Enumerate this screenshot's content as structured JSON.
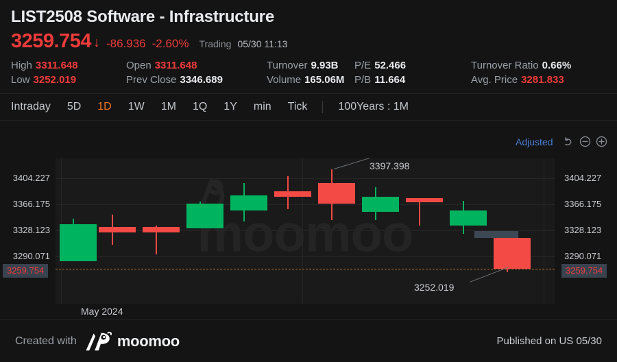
{
  "header": {
    "title": "LIST2508 Software - Infrastructure",
    "price": "3259.754",
    "arrow": "down-arrow-icon",
    "change": "-86.936",
    "change_pct": "-2.60%",
    "status": "Trading",
    "timestamp": "05/30 11:13",
    "accent_down": "#ef3b3a",
    "accent_active": "#f07423"
  },
  "stats": [
    {
      "key": "High",
      "value": "3311.648",
      "red": true
    },
    {
      "key": "Open",
      "value": "3311.648",
      "red": true
    },
    {
      "key": "Turnover",
      "value": "9.93B",
      "red": false
    },
    {
      "key": "P/E",
      "value": "52.466",
      "red": false
    },
    {
      "key": "Turnover Ratio",
      "value": "0.66%",
      "red": false
    },
    {
      "key": "Low",
      "value": "3252.019",
      "red": true
    },
    {
      "key": "Prev Close",
      "value": "3346.689",
      "red": false
    },
    {
      "key": "Volume",
      "value": "165.06M",
      "red": false
    },
    {
      "key": "P/B",
      "value": "11.664",
      "red": false
    },
    {
      "key": "Avg. Price",
      "value": "3281.833",
      "red": true
    }
  ],
  "tabs": [
    {
      "label": "Intraday",
      "active": false
    },
    {
      "label": "5D",
      "active": false
    },
    {
      "label": "1D",
      "active": true
    },
    {
      "label": "1W",
      "active": false
    },
    {
      "label": "1M",
      "active": false
    },
    {
      "label": "1Q",
      "active": false
    },
    {
      "label": "1Y",
      "active": false
    },
    {
      "label": "min",
      "active": false
    },
    {
      "label": "Tick",
      "active": false
    }
  ],
  "tabs_extra": "100Years : 1M",
  "chart_toolbar": {
    "adjusted_label": "Adjusted",
    "undo_icon": "undo-icon",
    "zoom_out_icon": "minus-circle-icon",
    "zoom_in_icon": "plus-circle-icon"
  },
  "chart_data": {
    "type": "candlestick",
    "title": "LIST2508 Software - Infrastructure",
    "xlabel": "",
    "ylabel": "",
    "ylim": [
      3240.0,
      3423.0
    ],
    "grid": true,
    "y_ticks": [
      "3404.227",
      "3366.175",
      "3328.123",
      "3290.071"
    ],
    "x_tick_label": "May 2024",
    "last_price": "3259.754",
    "annotations": [
      {
        "text": "3397.398",
        "role": "period-high"
      },
      {
        "text": "3252.019",
        "role": "period-low"
      }
    ],
    "candles": [
      {
        "open": 3290.0,
        "close": 3330.5,
        "high": 3335.0,
        "low": 3290.0,
        "dir": "up"
      },
      {
        "open": 3333.5,
        "close": 3330.5,
        "high": 3349.0,
        "low": 3320.0,
        "dir": "down"
      },
      {
        "open": 3334.0,
        "close": 3330.0,
        "high": 3336.0,
        "low": 3307.0,
        "dir": "down"
      },
      {
        "open": 3328.0,
        "close": 3358.0,
        "high": 3359.0,
        "low": 3328.0,
        "dir": "up"
      },
      {
        "open": 3355.0,
        "close": 3372.0,
        "high": 3386.0,
        "low": 3349.0,
        "dir": "up"
      },
      {
        "open": 3374.5,
        "close": 3372.0,
        "high": 3390.0,
        "low": 3362.0,
        "dir": "down"
      },
      {
        "open": 3379.0,
        "close": 3356.0,
        "high": 3397.398,
        "low": 3343.0,
        "dir": "down"
      },
      {
        "open": 3355.0,
        "close": 3368.0,
        "high": 3378.0,
        "low": 3345.0,
        "dir": "up"
      },
      {
        "open": 3366.0,
        "close": 3364.0,
        "high": 3368.0,
        "low": 3339.0,
        "dir": "down"
      },
      {
        "open": 3329.0,
        "close": 3340.0,
        "high": 3352.0,
        "low": 3322.0,
        "dir": "up"
      },
      {
        "open": 3305.0,
        "close": 3259.754,
        "high": 3305.0,
        "low": 3252.019,
        "dir": "down"
      }
    ]
  },
  "axis_right_ticks": [
    "3404.227",
    "3366.175",
    "3328.123",
    "3290.071"
  ],
  "footer": {
    "created_with": "Created with",
    "brand": "moomoo",
    "brand_logo": "moomoo-bull-logo",
    "published": "Published on US 05/30"
  }
}
